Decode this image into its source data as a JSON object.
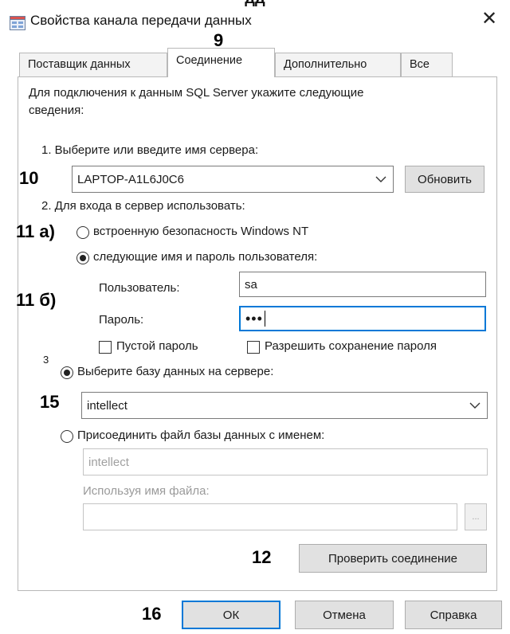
{
  "top_cut_text": "дд",
  "window": {
    "title": "Свойства канала передачи данных",
    "close_glyph": "✕"
  },
  "annotations": {
    "tab_num": "9",
    "server_num": "10",
    "auth_a": "11 а)",
    "auth_b": "11 б)",
    "db_small": "3",
    "db_num": "15",
    "test_num": "12",
    "ok_num": "16"
  },
  "tabs": [
    {
      "label": "Поставщик данных",
      "active": false
    },
    {
      "label": "Соединение",
      "active": true
    },
    {
      "label": "Дополнительно",
      "active": false
    },
    {
      "label": "Все",
      "active": false
    }
  ],
  "intro": {
    "line1": "Для подключения к данным SQL Server укажите следующие",
    "line2": "сведения:"
  },
  "server": {
    "label": "1. Выберите или введите имя сервера:",
    "value": "LAPTOP-A1L6J0C6",
    "refresh_label": "Обновить"
  },
  "auth": {
    "label": "2. Для входа в сервер использовать:",
    "option_nt": "встроенную безопасность Windows NT",
    "option_user": "следующие имя и пароль пользователя:",
    "user_label": "Пользователь:",
    "user_value": "sa",
    "password_label": "Пароль:",
    "password_value": "•••",
    "blank_password": "Пустой пароль",
    "allow_save": "Разрешить сохранение пароля"
  },
  "database": {
    "option_select": "Выберите базу данных на сервере:",
    "select_value": "intellect",
    "option_attach": "Присоединить файл базы данных с именем:",
    "attach_value": "intellect",
    "filename_label": "Используя имя файла:",
    "browse_label": "...",
    "test_label": "Проверить соединение"
  },
  "footer": {
    "ok": "ОК",
    "cancel": "Отмена",
    "help": "Справка"
  },
  "colors": {
    "accent": "#0078d7",
    "border": "#b8b8b8"
  }
}
